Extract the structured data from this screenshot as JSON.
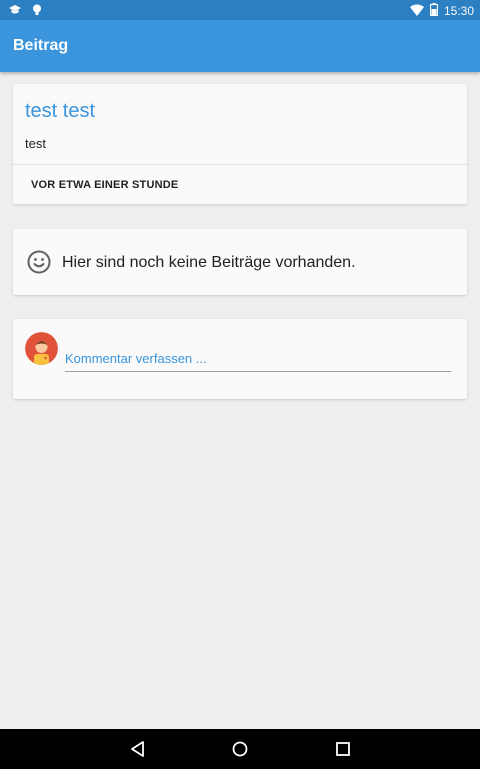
{
  "status_bar": {
    "time": "15:30",
    "icons_left": [
      "graduation-cap-icon",
      "lightbulb-icon"
    ],
    "icons_right": [
      "wifi-icon",
      "battery-icon"
    ]
  },
  "app_bar": {
    "title": "Beitrag"
  },
  "post": {
    "title": "test test",
    "body": "test",
    "time_label": "VOR ETWA EINER STUNDE"
  },
  "empty_state": {
    "icon": "smiley-icon",
    "text": "Hier sind noch keine Beiträge vorhanden."
  },
  "comment": {
    "placeholder": "Kommentar verfassen ..."
  },
  "nav_bar": {
    "buttons": [
      "back-icon",
      "home-icon",
      "recents-icon"
    ]
  },
  "colors": {
    "accent": "#3a95dd",
    "status_bar": "#2b7fc3",
    "background": "#eeeeee"
  }
}
